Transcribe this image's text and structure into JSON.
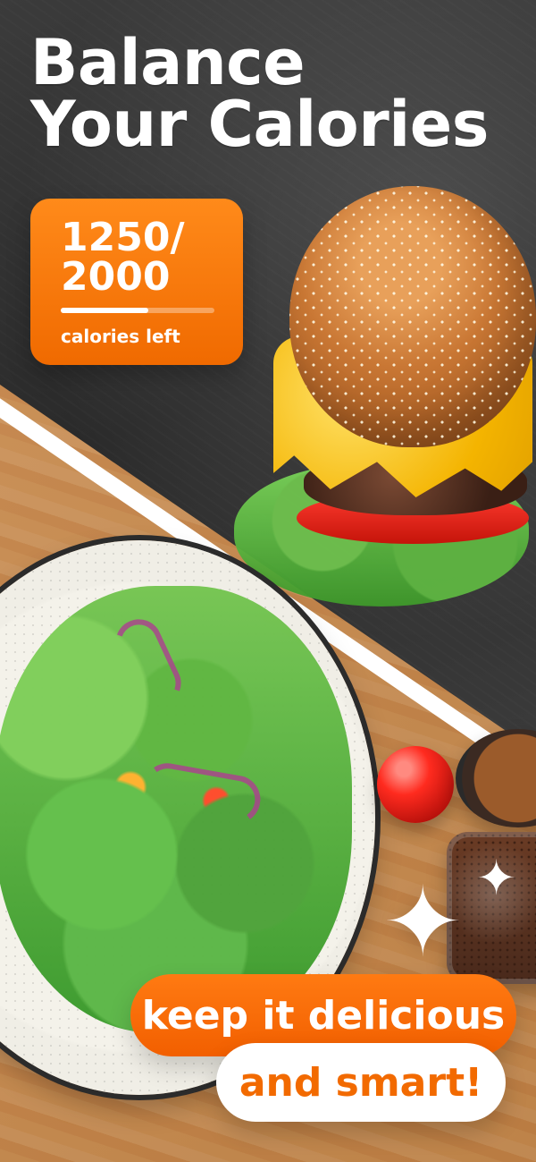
{
  "headline": {
    "line1": "Balance",
    "line2": "Your Calories"
  },
  "calories": {
    "display": "1250/\n2000",
    "caption": "calories left",
    "progress_fraction": 0.57,
    "accent_color": "#F06A00"
  },
  "tagline": {
    "line1": "keep it delicious",
    "line2": "and smart!"
  },
  "icons": {
    "sparkle_large": "four-point-sparkle",
    "sparkle_small": "four-point-sparkle"
  }
}
